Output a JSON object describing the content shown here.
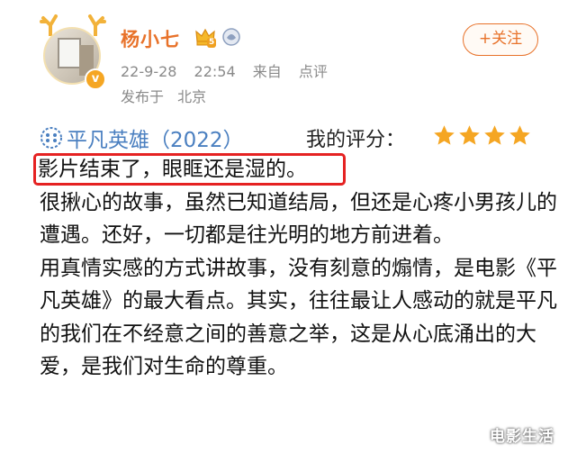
{
  "user": {
    "name": "杨小七",
    "level": "5",
    "verified_icon": "v-badge-icon"
  },
  "post_meta": {
    "date": "22-9-28",
    "time": "22:54",
    "source_prefix": "来自",
    "source": "点评",
    "location_prefix": "发布于",
    "location": "北京"
  },
  "follow_button": {
    "label": "+关注"
  },
  "review": {
    "movie_title": "平凡英雄（2022）",
    "rating_label": "我的评分：",
    "stars": 4,
    "highlight": "影片结束了，眼眶还是湿的。",
    "paragraphs": [
      "很揪心的故事，虽然已知道结局，但还是心疼小男孩儿的遭遇。还好，一切都是往光明的地方前进着。",
      "用真情实感的方式讲故事，没有刻意的煽情，是电影《平凡英雄》的最大看点。其实，往往最让人感动的就是平凡的我们在不经意之间的善意之举，这是从心底涌出的大爱，是我们对生命的尊重。"
    ]
  },
  "colors": {
    "username": "#e8722a",
    "link": "#4a7fc0",
    "highlight_border": "#e52222",
    "star": "#f5a623"
  },
  "watermark": "电影生活"
}
